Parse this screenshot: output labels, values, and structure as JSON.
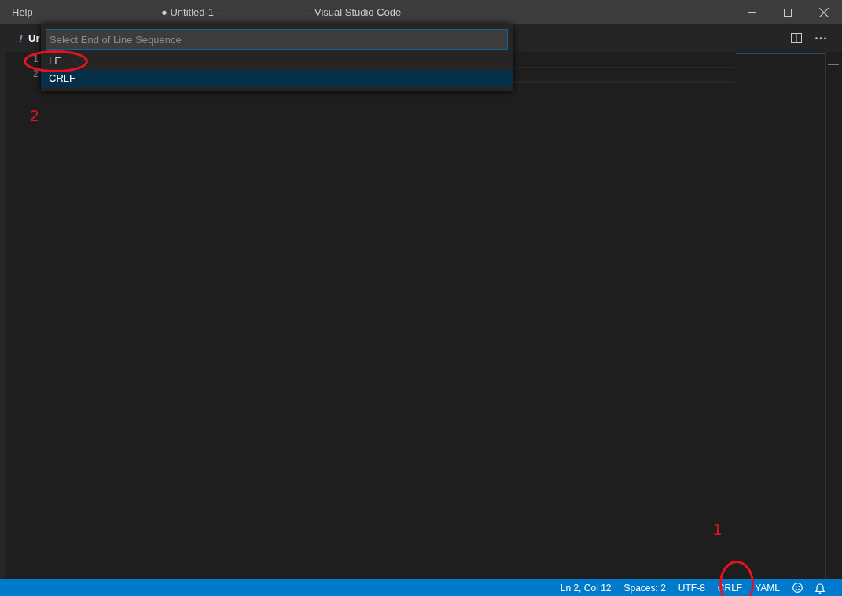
{
  "title_bar": {
    "menu": [
      "Help"
    ],
    "title_left": "● Untitled-1 -",
    "title_right": "- Visual Studio Code"
  },
  "tab": {
    "icon": "!",
    "label": "Ur"
  },
  "editor": {
    "line_numbers": [
      "1",
      "2"
    ]
  },
  "quick_pick": {
    "placeholder": "Select End of Line Sequence",
    "items": [
      {
        "label": "LF",
        "selected": false
      },
      {
        "label": "CRLF",
        "selected": true
      }
    ]
  },
  "status_bar": {
    "items": [
      "Ln 2, Col 12",
      "Spaces: 2",
      "UTF-8",
      "CRLF",
      "YAML"
    ]
  },
  "annotations": [
    {
      "label": "1"
    },
    {
      "label": "2"
    }
  ]
}
